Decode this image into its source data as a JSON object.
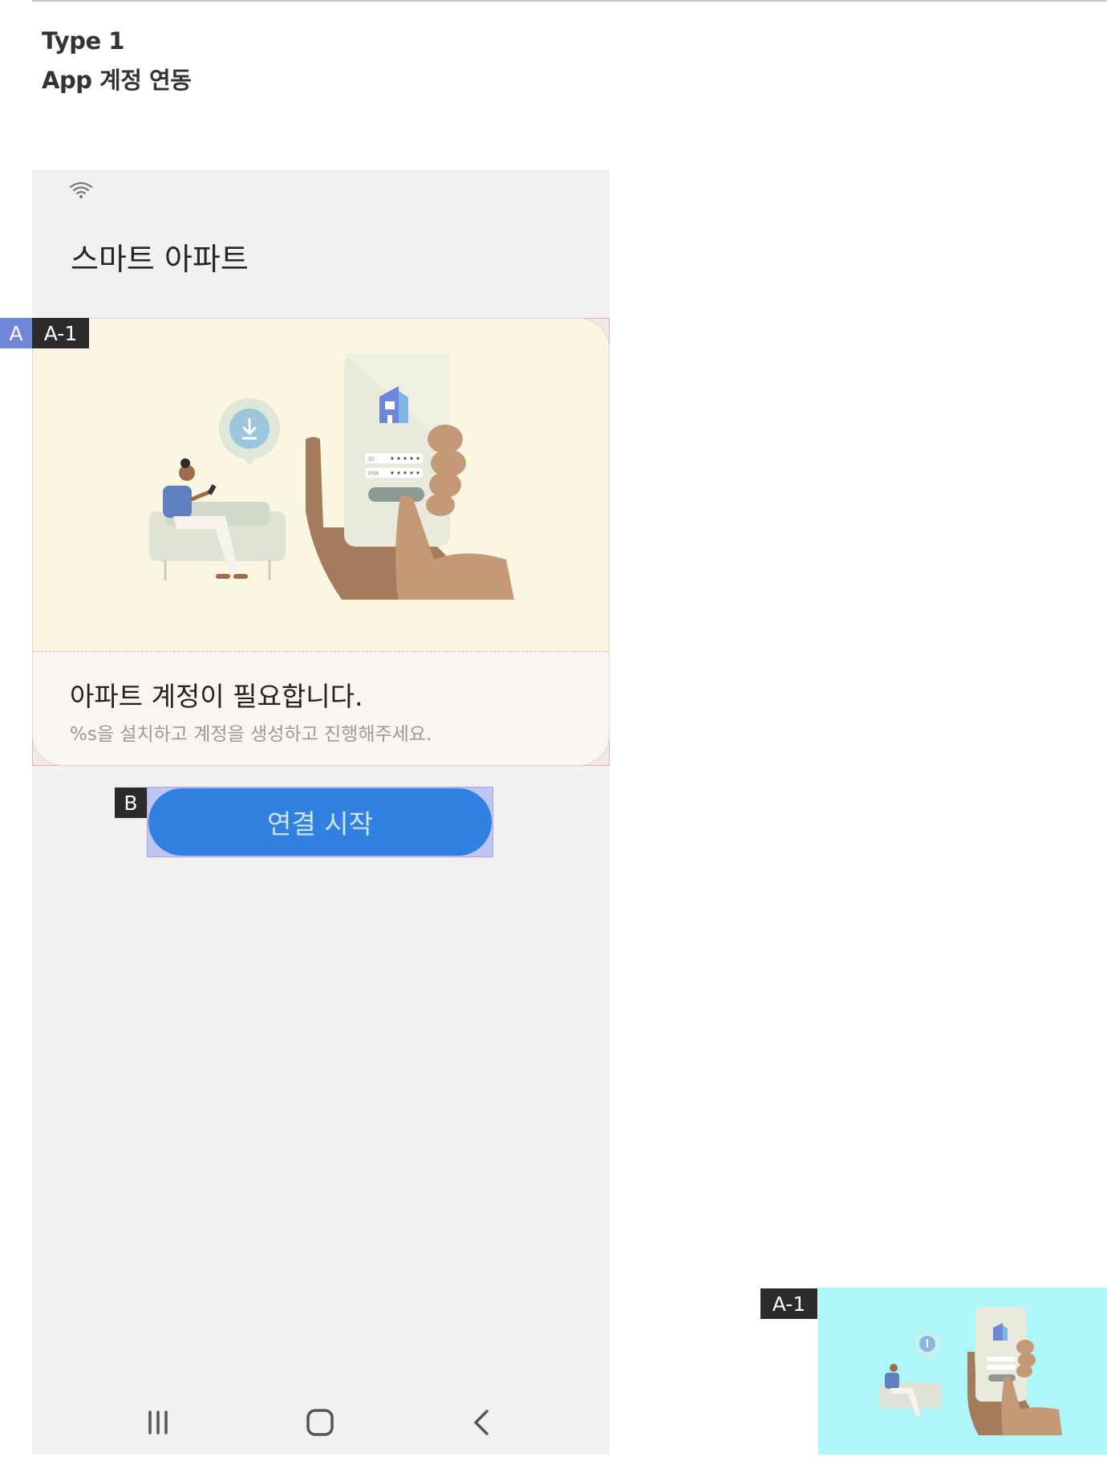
{
  "spec": {
    "type_label": "Type 1",
    "subtitle": "App 계정 연동"
  },
  "status_bar": {
    "icon": "wifi-icon"
  },
  "app": {
    "title": "스마트 아파트"
  },
  "card": {
    "illustration": "account-login-illustration",
    "title": "아파트 계정이 필요합니다.",
    "description": "%s을 설치하고 계정을 생성하고 진행해주세요."
  },
  "connect_button": {
    "label": "연결 시작",
    "color": "#3181e0"
  },
  "nav": {
    "items": [
      "recent-apps-icon",
      "home-icon",
      "back-icon"
    ]
  },
  "annotations": {
    "a": "A",
    "a1": "A-1",
    "b": "B",
    "thumb_label": "A-1",
    "a_color": "#6e86d8",
    "thumb_background": "#aef6f8"
  },
  "illustration_labels": {
    "id_label": "ID",
    "pw_label": "P/W"
  }
}
